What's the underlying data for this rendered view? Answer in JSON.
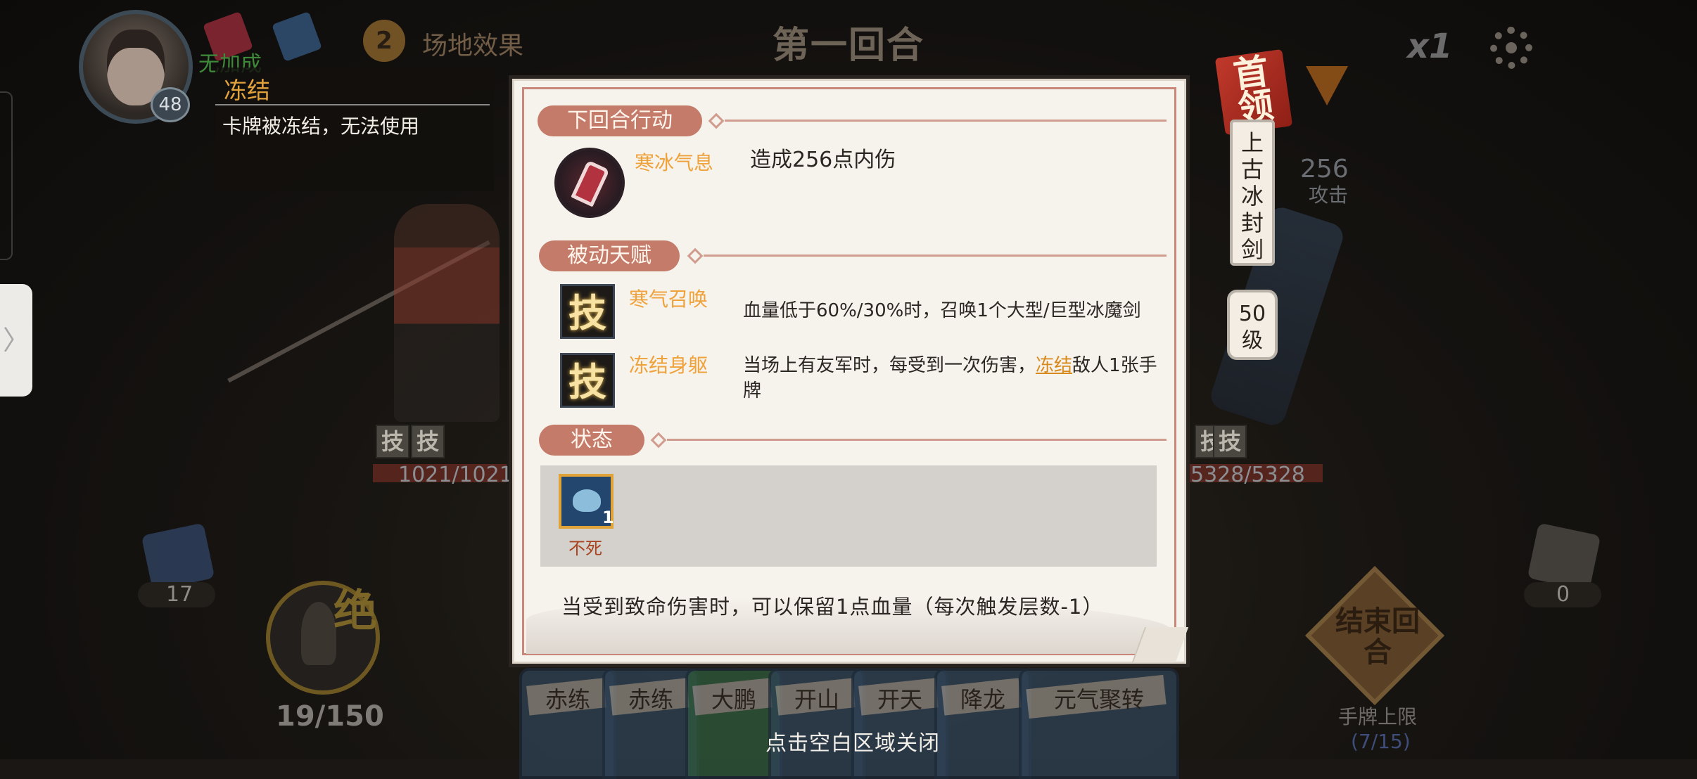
{
  "hud": {
    "hero_level": "48",
    "no_bonus": "无加成",
    "field_effect_count": "2",
    "field_effect_label": "场地效果",
    "round_title": "第一回合",
    "speed": "x1"
  },
  "tooltip": {
    "title": "冻结",
    "desc": "卡牌被冻结，无法使用"
  },
  "boss": {
    "tag": "首领",
    "name": "上古冰封剑",
    "level": "50级",
    "intent_value": "256",
    "intent_label": "攻击"
  },
  "battle": {
    "hero_hp": "1021/1021",
    "boss_hp": "5328/5328",
    "hero_skill_marks": [
      "技",
      "技"
    ],
    "boss_skill_marks": [
      "技",
      "技"
    ]
  },
  "bottom": {
    "deck_count": "17",
    "meditate_label": "绝",
    "energy": "19/150",
    "discard_count": "0",
    "end_turn": "结束回合",
    "hand_limit_label": "手牌上限",
    "hand_limit_value": "(7/15)",
    "close_hint": "点击空白区域关闭"
  },
  "hand_cards": [
    "赤练",
    "赤练",
    "大鹏",
    "开山",
    "开天",
    "降龙",
    "元气聚转"
  ],
  "modal": {
    "next_action_header": "下回合行动",
    "next_action": {
      "name": "寒冰气息",
      "desc": "造成256点内伤",
      "icon": "sword-icon"
    },
    "passive_header": "被动天赋",
    "passives": [
      {
        "icon_char": "技",
        "name": "寒气召唤",
        "desc": "血量低于60%/30%时，召唤1个大型/巨型冰魔剑"
      },
      {
        "icon_char": "技",
        "name": "冻结身躯",
        "desc_pre": "当场上有友军时，每受到一次伤害，",
        "desc_link": "冻结",
        "desc_post": "敌人1张手牌"
      }
    ],
    "status_header": "状态",
    "status": {
      "name": "不死",
      "stack": "1",
      "icon": "undying-icon",
      "desc": "当受到致命伤害时，可以保留1点血量（每次触发层数-1）"
    }
  },
  "colors": {
    "accent_tab": "#c47b6a",
    "skill_name": "#f0a23a",
    "status_name": "#a8421f",
    "boss_ribbon": "#c0392b"
  }
}
